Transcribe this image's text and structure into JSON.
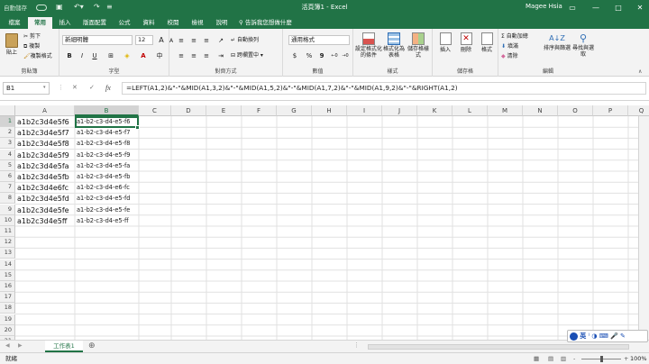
{
  "window": {
    "title": "活頁簿1 - Excel",
    "user": "Magee Hsia",
    "autosave": "自動儲存",
    "controls": {
      "restore": "▭",
      "minimize": "—",
      "maximize": "□",
      "close": "✕"
    }
  },
  "tabs": [
    {
      "label": "檔案",
      "active": false
    },
    {
      "label": "常用",
      "active": true
    },
    {
      "label": "插入",
      "active": false
    },
    {
      "label": "版面配置",
      "active": false
    },
    {
      "label": "公式",
      "active": false
    },
    {
      "label": "資料",
      "active": false
    },
    {
      "label": "校閱",
      "active": false
    },
    {
      "label": "檢視",
      "active": false
    },
    {
      "label": "說明",
      "active": false
    }
  ],
  "tell_me": "告訴我您想做什麼",
  "ribbon": {
    "clipboard": {
      "label": "剪貼簿",
      "paste": "貼上",
      "cut": "剪下",
      "copy": "複製",
      "format_painter": "複製格式"
    },
    "font": {
      "label": "字型",
      "name": "新細明體",
      "size": "12",
      "grow": "A",
      "shrink": "A",
      "bold": "B",
      "italic": "I",
      "underline": "U",
      "change_case": "中"
    },
    "alignment": {
      "label": "對齊方式",
      "wrap": "自動換列",
      "merge": "跨欄置中"
    },
    "number": {
      "label": "數值",
      "format": "通用格式",
      "currency": "$",
      "percent": "%",
      "comma": "9"
    },
    "styles": {
      "label": "樣式",
      "conditional": "設定格式化的條件",
      "table": "格式化為表格",
      "cell": "儲存格樣式"
    },
    "cells": {
      "label": "儲存格",
      "insert": "插入",
      "delete": "刪除",
      "format": "格式"
    },
    "editing": {
      "label": "編輯",
      "autosum": "自動加總",
      "fill": "填滿",
      "clear": "清除",
      "sort": "排序與篩選",
      "find": "尋找與選取"
    }
  },
  "formula_bar": {
    "name_box": "B1",
    "cancel": "✕",
    "enter": "✓",
    "fx": "fx",
    "formula": "=LEFT(A1,2)&\"-\"&MID(A1,3,2)&\"-\"&MID(A1,5,2)&\"-\"&MID(A1,7,2)&\"-\"&MID(A1,9,2)&\"-\"&RIGHT(A1,2)"
  },
  "sheet": {
    "columns": [
      "A",
      "B",
      "C",
      "D",
      "E",
      "F",
      "G",
      "H",
      "I",
      "J",
      "K",
      "L",
      "M",
      "N",
      "O",
      "P",
      "Q"
    ],
    "rows": [
      1,
      2,
      3,
      4,
      5,
      6,
      7,
      8,
      9,
      10,
      11,
      12,
      13,
      14,
      15,
      16,
      17,
      18,
      19,
      20,
      21
    ],
    "selected_column": "B",
    "selected_row": 1,
    "data": [
      [
        "a1b2c3d4e5f6",
        "a1-b2-c3-d4-e5-f6"
      ],
      [
        "a1b2c3d4e5f7",
        "a1-b2-c3-d4-e5-f7"
      ],
      [
        "a1b2c3d4e5f8",
        "a1-b2-c3-d4-e5-f8"
      ],
      [
        "a1b2c3d4e5f9",
        "a1-b2-c3-d4-e5-f9"
      ],
      [
        "a1b2c3d4e5fa",
        "a1-b2-c3-d4-e5-fa"
      ],
      [
        "a1b2c3d4e5fb",
        "a1-b2-c3-d4-e5-fb"
      ],
      [
        "a1b2c3d4e6fc",
        "a1-b2-c3-d4-e6-fc"
      ],
      [
        "a1b2c3d4e5fd",
        "a1-b2-c3-d4-e5-fd"
      ],
      [
        "a1b2c3d4e5fe",
        "a1-b2-c3-d4-e5-fe"
      ],
      [
        "a1b2c3d4e5ff",
        "a1-b2-c3-d4-e5-ff"
      ]
    ],
    "tab_name": "工作表1",
    "add_sheet": "⊕"
  },
  "status": {
    "ready": "就緒",
    "zoom": "100%",
    "zoom_minus": "-",
    "zoom_plus": "+"
  },
  "ime": {
    "mode": "英",
    "items": "⁾ ◑ ⌨ 🎤 ✎"
  },
  "colors": {
    "accent": "#217346",
    "ribbon_bg": "#f3f3f3"
  }
}
